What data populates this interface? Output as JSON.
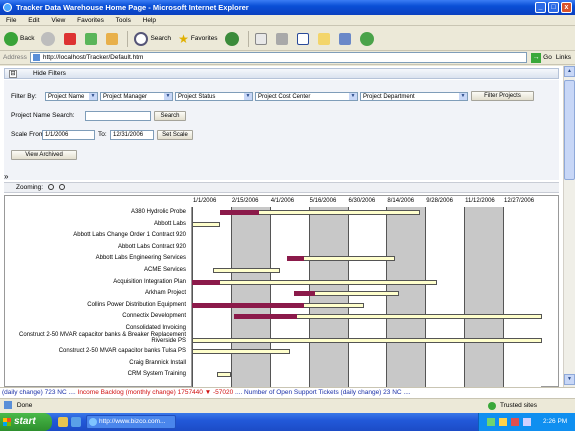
{
  "window": {
    "title": "Tracker Data Warehouse Home Page - Microsoft Internet Explorer",
    "min": "_",
    "max": "□",
    "close": "x"
  },
  "menu": [
    "File",
    "Edit",
    "View",
    "Favorites",
    "Tools",
    "Help"
  ],
  "toolbar": {
    "back": "Back",
    "search": "Search",
    "favorites": "Favorites"
  },
  "address": {
    "label": "Address",
    "url": "http://localhost/Tracker/Default.htm",
    "go": "Go",
    "links": "Links"
  },
  "filters": {
    "toggle": "⊟",
    "header": "Hide Filters",
    "filter_by": "Filter By:",
    "selects": [
      "Project Name",
      "Project Manager",
      "Project Status",
      "Project Cost Center",
      "Project Department"
    ],
    "filter_button": "Filter Projects",
    "search_label": "Project Name Search:",
    "search_value": "",
    "search_button": "Search",
    "scale_from_label": "Scale From:",
    "scale_from": "1/1/2006",
    "to_label": "To:",
    "scale_to": "12/31/2006",
    "set_scale": "Set Scale",
    "view_archived": "View Archived"
  },
  "expander": "»",
  "zoom": {
    "label": "Zooming:"
  },
  "gantt": {
    "dates": [
      "1/1/2006",
      "2/15/2006",
      "4/1/2006",
      "5/16/2006",
      "6/30/2006",
      "8/14/2006",
      "9/28/2006",
      "11/12/2006",
      "12/27/2006"
    ],
    "rows": [
      {
        "name": "A380 Hydrolic Probe",
        "start": 0.08,
        "end": 0.65,
        "pstart": 0.08,
        "pend": 0.19
      },
      {
        "name": "Abbott Labs",
        "start": 0.0,
        "end": 0.08,
        "pstart": null,
        "pend": null
      },
      {
        "name": "Abbott Labs Change Order 1 Contract 920",
        "start": null,
        "end": null,
        "pstart": null,
        "pend": null
      },
      {
        "name": "Abbott Labs Contract 920",
        "start": null,
        "end": null,
        "pstart": null,
        "pend": null
      },
      {
        "name": "Abbott Labs Engineering Services",
        "start": 0.27,
        "end": 0.58,
        "pstart": 0.27,
        "pend": 0.32
      },
      {
        "name": "ACME Services",
        "start": 0.06,
        "end": 0.25,
        "pstart": null,
        "pend": null
      },
      {
        "name": "Acquisition Integration Plan",
        "start": 0.0,
        "end": 0.7,
        "pstart": 0.0,
        "pend": 0.08
      },
      {
        "name": "Arkham Project",
        "start": 0.29,
        "end": 0.59,
        "pstart": 0.29,
        "pend": 0.35
      },
      {
        "name": "Collins Power Distribution Equipment",
        "start": 0.0,
        "end": 0.49,
        "pstart": 0.0,
        "pend": 0.32
      },
      {
        "name": "Connectix Development",
        "start": 0.12,
        "end": 1.0,
        "pstart": 0.12,
        "pend": 0.3
      },
      {
        "name": "Consolidated Invoicing",
        "start": null,
        "end": null,
        "pstart": null,
        "pend": null
      },
      {
        "name": "Construct 2-50 MVAR capacitor banks & Breaker Replacement Riverside PS",
        "start": 0.0,
        "end": 1.0,
        "pstart": null,
        "pend": null
      },
      {
        "name": "Construct 2-50 MVAR capacitor banks Tulsa PS",
        "start": 0.0,
        "end": 0.28,
        "pstart": null,
        "pend": null
      },
      {
        "name": "Craig Brannick Install",
        "start": null,
        "end": null,
        "pstart": null,
        "pend": null
      },
      {
        "name": "CRM System Training",
        "start": 0.07,
        "end": 0.11,
        "pstart": null,
        "pend": null
      }
    ]
  },
  "ticker": {
    "t1": "(daily change) 723 NC ....",
    "t2": "Income Backlog (monthly change) 1757440",
    "arrow": "▼",
    "t3": "-57020",
    "t4": ".... Number of Open Support Tickets (daily change) 23 NC ...."
  },
  "status": {
    "done": "Done",
    "zone": "Trusted sites"
  },
  "taskbar": {
    "start": "start",
    "task": "http://www.bizco.com...",
    "time": "2:26 PM"
  },
  "colors": {
    "progress": "#8b1a4a",
    "bar": "#ffffcc",
    "titlebar": "#0a4fd6"
  }
}
